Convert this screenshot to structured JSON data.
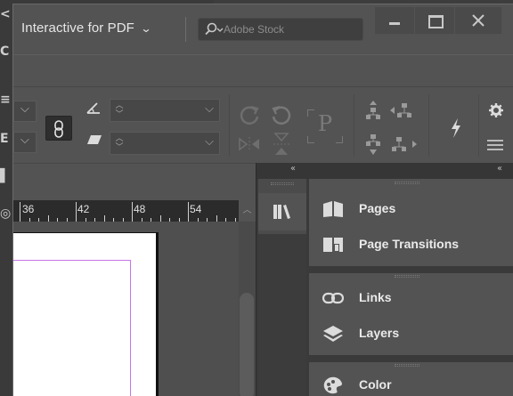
{
  "titlebar": {
    "workspace_label": "Interactive for PDF",
    "search_placeholder": "Adobe Stock"
  },
  "ruler": {
    "labels": [
      "36",
      "42",
      "48",
      "54"
    ]
  },
  "panels": {
    "items": [
      {
        "label": "Pages",
        "icon": "pages-icon"
      },
      {
        "label": "Page Transitions",
        "icon": "page-transitions-icon"
      },
      {
        "label": "Links",
        "icon": "links-icon"
      },
      {
        "label": "Layers",
        "icon": "layers-icon"
      },
      {
        "label": "Color",
        "icon": "color-icon"
      }
    ]
  },
  "colors": {
    "ui_background": "#535353",
    "dark_panel": "#3a3a3a",
    "margin_guide": "#c974e8",
    "page": "#ffffff"
  }
}
